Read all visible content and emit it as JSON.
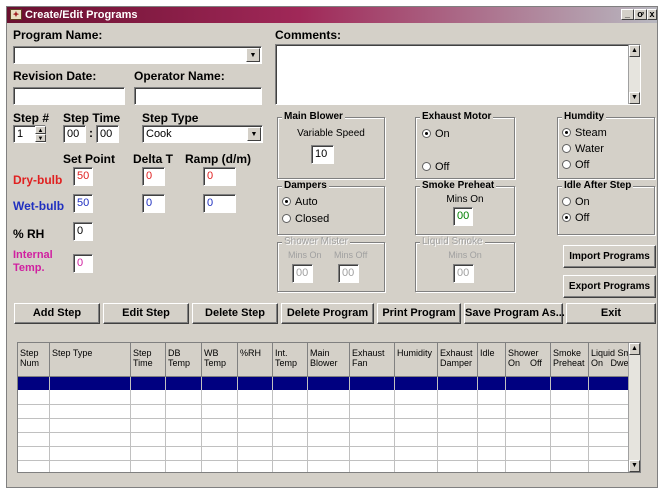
{
  "window": {
    "title": "Create/Edit Programs",
    "controls": [
      "_",
      "ơ",
      "x"
    ]
  },
  "program": {
    "name_label": "Program Name:",
    "name_value": "",
    "revision_label": "Revision Date:",
    "revision_value": "",
    "operator_label": "Operator Name:",
    "operator_value": "",
    "comments_label": "Comments:",
    "comments_value": ""
  },
  "step": {
    "step_label": "Step #",
    "step_value": "1",
    "time_label": "Step Time",
    "time_hh": "00",
    "time_sep": ":",
    "time_mm": "00",
    "type_label": "Step Type",
    "type_value": "Cook"
  },
  "setpoints": {
    "setpoint_label": "Set Point",
    "delta_label": "Delta T",
    "ramp_label": "Ramp (d/m)",
    "rows": [
      {
        "label": "Dry-bulb",
        "setpoint": "50",
        "delta": "0",
        "ramp": "0",
        "color": "#e02020"
      },
      {
        "label": "Wet-bulb",
        "setpoint": "50",
        "delta": "0",
        "ramp": "0",
        "color": "#2030c0"
      }
    ],
    "rh_label": "% RH",
    "rh_value": "0",
    "internal_label_1": "Internal",
    "internal_label_2": "Temp.",
    "internal_value": "0",
    "internal_color": "#d020a0"
  },
  "main_blower": {
    "title": "Main Blower",
    "sub": "Variable Speed",
    "value": "10"
  },
  "exhaust_motor": {
    "title": "Exhaust Motor",
    "on": "On",
    "off": "Off",
    "selected": "On"
  },
  "humidity": {
    "title": "Humdity",
    "options": [
      "Steam",
      "Water",
      "Off"
    ],
    "selected": "Steam"
  },
  "dampers": {
    "title": "Dampers",
    "options": [
      "Auto",
      "Closed"
    ],
    "selected": "Auto"
  },
  "smoke_preheat": {
    "title": "Smoke Preheat",
    "sub": "Mins On",
    "value": "00"
  },
  "idle_after_step": {
    "title": "Idle After Step",
    "options": [
      "On",
      "Off"
    ],
    "selected": "Off"
  },
  "shower_mister": {
    "title": "Shower Mister",
    "mins_on_label": "Mins On",
    "mins_off_label": "Mins Off",
    "mins_on": "00",
    "mins_off": "00"
  },
  "liquid_smoke": {
    "title": "Liquid Smoke",
    "sub": "Mins On",
    "value": "00"
  },
  "side_buttons": {
    "import": "Import Programs",
    "export": "Export Programs"
  },
  "action_buttons": [
    "Add Step",
    "Edit Step",
    "Delete Step",
    "Delete Program",
    "Print Program",
    "Save Program As...",
    "Exit"
  ],
  "grid": {
    "headers": [
      {
        "l1": "Step",
        "l2": "Num"
      },
      {
        "l1": "Step Type",
        "l2": ""
      },
      {
        "l1": "Step",
        "l2": "Time"
      },
      {
        "l1": "DB",
        "l2": "Temp"
      },
      {
        "l1": "WB",
        "l2": "Temp"
      },
      {
        "l1": "%RH",
        "l2": ""
      },
      {
        "l1": "Int.",
        "l2": "Temp"
      },
      {
        "l1": "Main",
        "l2": "Blower"
      },
      {
        "l1": "Exhaust",
        "l2": "Fan"
      },
      {
        "l1": "Humidity",
        "l2": ""
      },
      {
        "l1": "Exhaust",
        "l2": "Damper"
      },
      {
        "l1": "Idle",
        "l2": ""
      },
      {
        "l1": "Shower",
        "l2": "On    Off"
      },
      {
        "l1": "Smoke",
        "l2": "Preheat"
      },
      {
        "l1": "Liquid Smk",
        "l2": "On   Dwell"
      }
    ]
  }
}
